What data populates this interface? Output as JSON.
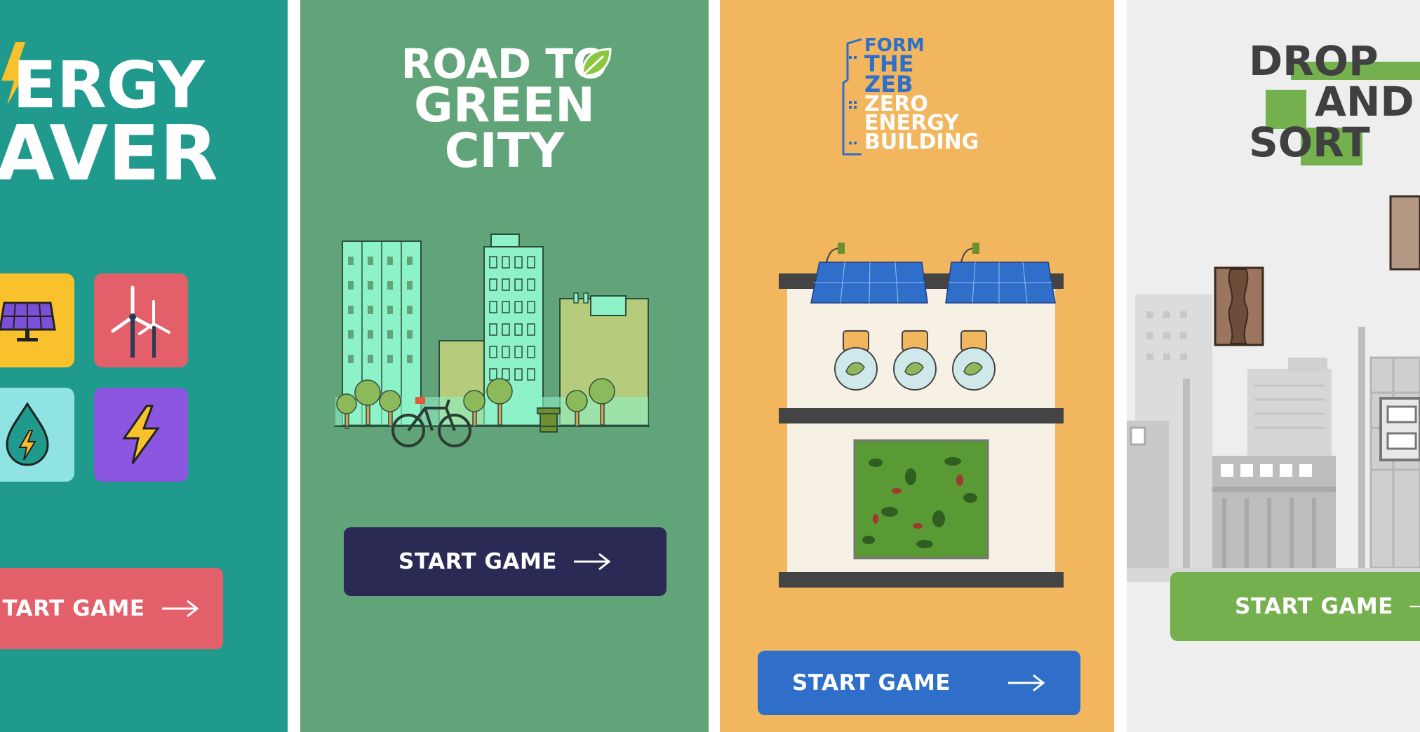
{
  "panels": [
    {
      "title_lines": [
        "ERGY",
        "AVER"
      ],
      "title_lead_mark": "N",
      "tiles": [
        "solar-panel-icon",
        "wind-turbine-icon",
        "water-energy-icon",
        "lightning-icon"
      ],
      "button": {
        "label": "TART GAME",
        "arrow": "→"
      },
      "colors": {
        "bg": "#1f9a8c",
        "button": "#e3606b",
        "tile_yellow": "#f9c12c",
        "tile_red": "#e3606b",
        "tile_aqua": "#8fe3e3",
        "tile_purple": "#8b57e0"
      }
    },
    {
      "title_lines": [
        "ROAD TO",
        "GREEN",
        "CITY"
      ],
      "illustration": "green-city-skyline",
      "button": {
        "label": "START GAME",
        "arrow": "→"
      },
      "colors": {
        "bg": "#62a479",
        "button": "#2b2a55",
        "buildings": "#8ef2c8"
      }
    },
    {
      "title_lines": [
        "FORM",
        "THE",
        "ZEB",
        "ZERO",
        "ENERGY",
        "BUILDING"
      ],
      "illustration": "zero-energy-building",
      "button": {
        "label": "START GAME",
        "arrow": "→"
      },
      "colors": {
        "bg": "#f2b65e",
        "button": "#2f6fc9",
        "title_blue": "#2f6fc9"
      }
    },
    {
      "title_lines": [
        "DROP",
        "AND",
        "SORT"
      ],
      "illustration": "grey-city-with-blocks",
      "button": {
        "label": "START GAME",
        "arrow": "→"
      },
      "colors": {
        "bg": "#eeeeee",
        "button": "#74b04d",
        "accent": "#74b04d"
      }
    }
  ]
}
